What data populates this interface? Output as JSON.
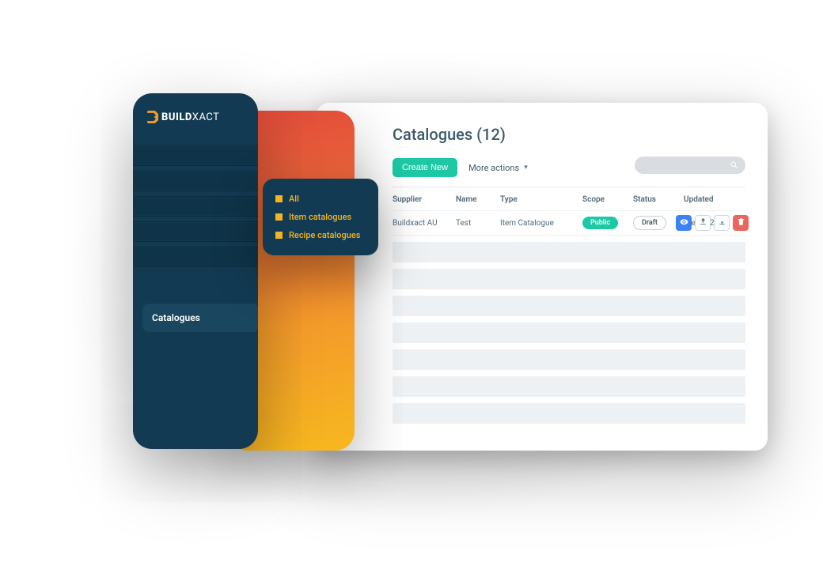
{
  "brand": {
    "prefix": "BUILD",
    "suffix": "XACT"
  },
  "sidebar": {
    "active_label": "Catalogues",
    "submenu": [
      {
        "label": "All"
      },
      {
        "label": "Item catalogues"
      },
      {
        "label": "Recipe catalogues"
      }
    ]
  },
  "page": {
    "title": "Catalogues (12)",
    "create_label": "Create New",
    "more_label": "More actions"
  },
  "columns": {
    "supplier": "Supplier",
    "name": "Name",
    "type": "Type",
    "scope": "Scope",
    "status": "Status",
    "updated": "Updated"
  },
  "rows": [
    {
      "supplier": "Buildxact AU",
      "name": "Test",
      "type": "Item Catalogue",
      "scope": "Public",
      "status": "Draft",
      "updated": "Feb 3, 2022"
    }
  ]
}
